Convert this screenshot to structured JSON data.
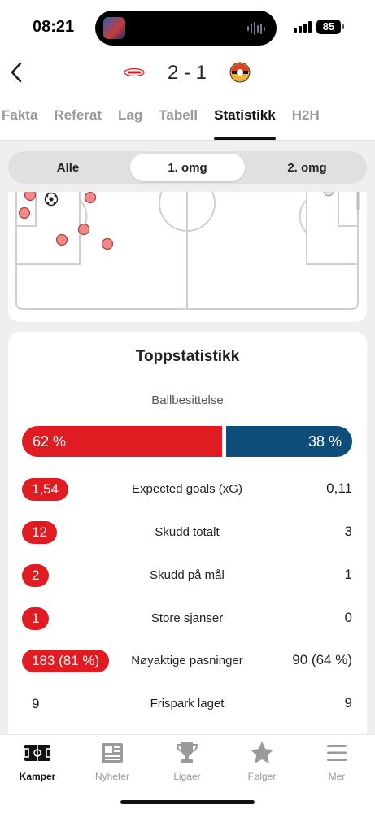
{
  "status_bar": {
    "time": "08:21",
    "battery": "85"
  },
  "match": {
    "home_team_icon": "brann-logo-icon",
    "away_team_icon": "stromsgodset-logo-icon",
    "score": "2 - 1"
  },
  "tabs": [
    {
      "label": "Fakta"
    },
    {
      "label": "Referat"
    },
    {
      "label": "Lag"
    },
    {
      "label": "Tabell"
    },
    {
      "label": "Statistikk",
      "active": true
    },
    {
      "label": "H2H"
    }
  ],
  "period_filter": [
    {
      "label": "Alle"
    },
    {
      "label": "1. omg",
      "active": true
    },
    {
      "label": "2. omg"
    }
  ],
  "colors": {
    "home": "#e01b22",
    "away": "#0f4d7a",
    "background": "#efefef"
  },
  "top_stats": {
    "title": "Toppstatistikk",
    "possession": {
      "label": "Ballbesittelse",
      "home": "62 %",
      "away": "38 %",
      "home_share": 0.62
    },
    "rows": [
      {
        "label": "Expected goals (xG)",
        "home": "1,54",
        "away": "0,11",
        "highlight": true
      },
      {
        "label": "Skudd totalt",
        "home": "12",
        "away": "3",
        "highlight": true
      },
      {
        "label": "Skudd på mål",
        "home": "2",
        "away": "1",
        "highlight": true
      },
      {
        "label": "Store sjanser",
        "home": "1",
        "away": "0",
        "highlight": true
      },
      {
        "label": "Nøyaktige pasninger",
        "home": "183 (81 %)",
        "away": "90 (64 %)",
        "highlight": true
      },
      {
        "label": "Frispark laget",
        "home": "9",
        "away": "9",
        "highlight": false
      }
    ]
  },
  "bottom_nav": [
    {
      "label": "Kamper",
      "icon": "pitch-icon",
      "active": true
    },
    {
      "label": "Nyheter",
      "icon": "news-icon"
    },
    {
      "label": "Ligaer",
      "icon": "trophy-icon"
    },
    {
      "label": "Følger",
      "icon": "star-icon"
    },
    {
      "label": "Mer",
      "icon": "menu-icon"
    }
  ]
}
